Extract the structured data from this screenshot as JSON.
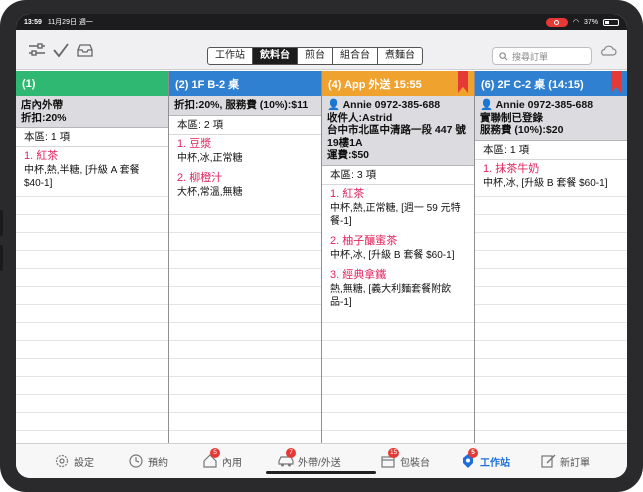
{
  "status_bar": {
    "time": "13:59",
    "date": "11月29日 週一",
    "battery": "37%"
  },
  "toolbar": {
    "segments": [
      "工作站",
      "飲料台",
      "煎台",
      "組合台",
      "煮麵台"
    ],
    "active_segment": "飲料台",
    "search_placeholder": "搜尋訂單"
  },
  "columns": [
    {
      "header": "(1)",
      "color": "#2eb872",
      "bookmark": false,
      "info": [
        "店內外帶",
        "折扣:20%"
      ],
      "area": "本區: 1 項",
      "items": [
        {
          "name": "1. 紅茶",
          "mods": "中杯,熱,半糖, [升級 A 套餐 $40-1]"
        }
      ]
    },
    {
      "header": "(2) 1F B-2 桌",
      "color": "#2f80d1",
      "bookmark": false,
      "info": [
        "折扣:20%, 服務費 (10%):$11"
      ],
      "area": "本區: 2 項",
      "items": [
        {
          "name": "1. 豆漿",
          "mods": "中杯,冰,正常糖"
        },
        {
          "name": "2. 柳橙汁",
          "mods": "大杯,常溫,無糖"
        }
      ]
    },
    {
      "header": "(4) App 外送 15:55",
      "color": "#f0a22e",
      "bookmark": true,
      "info": [
        "👤 Annie 0972-385-688",
        "收件人:Astrid",
        "台中市北區中清路一段 447 號19樓1A",
        "運費:$50"
      ],
      "area": "本區: 3 項",
      "items": [
        {
          "name": "1. 紅茶",
          "mods": "中杯,熱,正常糖, [週一 59 元特餐-1]"
        },
        {
          "name": "2. 柚子釀蜜茶",
          "mods": "中杯,冰, [升級 B 套餐 $60-1]"
        },
        {
          "name": "3. 經典拿鐵",
          "mods": "熱,無糖, [義大利麵套餐附飲品-1]"
        }
      ]
    },
    {
      "header": "(6) 2F C-2 桌 (14:15)",
      "color": "#2f80d1",
      "bookmark": true,
      "info": [
        "👤 Annie 0972-385-688",
        "實聯制已登錄",
        "服務費 (10%):$20"
      ],
      "area": "本區: 1 項",
      "items": [
        {
          "name": "1. 抹茶牛奶",
          "mods": "中杯,冰, [升級 B 套餐 $60-1]"
        }
      ]
    }
  ],
  "tabbar": [
    {
      "label": "設定",
      "icon": "gear-icon",
      "badge": ""
    },
    {
      "label": "預約",
      "icon": "clock-icon",
      "badge": ""
    },
    {
      "label": "內用",
      "icon": "house-icon",
      "badge": "5"
    },
    {
      "label": "外帶/外送",
      "icon": "car-icon",
      "badge": "7"
    },
    {
      "label": "包裝台",
      "icon": "box-icon",
      "badge": "15"
    },
    {
      "label": "工作站",
      "icon": "station-icon",
      "badge": "5",
      "active": true
    },
    {
      "label": "新訂單",
      "icon": "new-order-icon",
      "badge": ""
    }
  ]
}
